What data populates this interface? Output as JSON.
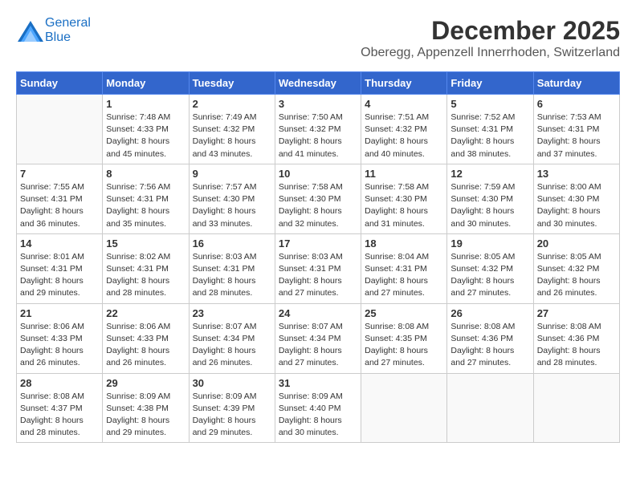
{
  "header": {
    "logo_line1": "General",
    "logo_line2": "Blue",
    "month_title": "December 2025",
    "subtitle": "Oberegg, Appenzell Innerrhoden, Switzerland"
  },
  "weekdays": [
    "Sunday",
    "Monday",
    "Tuesday",
    "Wednesday",
    "Thursday",
    "Friday",
    "Saturday"
  ],
  "weeks": [
    [
      {
        "day": "",
        "info": ""
      },
      {
        "day": "1",
        "info": "Sunrise: 7:48 AM\nSunset: 4:33 PM\nDaylight: 8 hours\nand 45 minutes."
      },
      {
        "day": "2",
        "info": "Sunrise: 7:49 AM\nSunset: 4:32 PM\nDaylight: 8 hours\nand 43 minutes."
      },
      {
        "day": "3",
        "info": "Sunrise: 7:50 AM\nSunset: 4:32 PM\nDaylight: 8 hours\nand 41 minutes."
      },
      {
        "day": "4",
        "info": "Sunrise: 7:51 AM\nSunset: 4:32 PM\nDaylight: 8 hours\nand 40 minutes."
      },
      {
        "day": "5",
        "info": "Sunrise: 7:52 AM\nSunset: 4:31 PM\nDaylight: 8 hours\nand 38 minutes."
      },
      {
        "day": "6",
        "info": "Sunrise: 7:53 AM\nSunset: 4:31 PM\nDaylight: 8 hours\nand 37 minutes."
      }
    ],
    [
      {
        "day": "7",
        "info": "Sunrise: 7:55 AM\nSunset: 4:31 PM\nDaylight: 8 hours\nand 36 minutes."
      },
      {
        "day": "8",
        "info": "Sunrise: 7:56 AM\nSunset: 4:31 PM\nDaylight: 8 hours\nand 35 minutes."
      },
      {
        "day": "9",
        "info": "Sunrise: 7:57 AM\nSunset: 4:30 PM\nDaylight: 8 hours\nand 33 minutes."
      },
      {
        "day": "10",
        "info": "Sunrise: 7:58 AM\nSunset: 4:30 PM\nDaylight: 8 hours\nand 32 minutes."
      },
      {
        "day": "11",
        "info": "Sunrise: 7:58 AM\nSunset: 4:30 PM\nDaylight: 8 hours\nand 31 minutes."
      },
      {
        "day": "12",
        "info": "Sunrise: 7:59 AM\nSunset: 4:30 PM\nDaylight: 8 hours\nand 30 minutes."
      },
      {
        "day": "13",
        "info": "Sunrise: 8:00 AM\nSunset: 4:30 PM\nDaylight: 8 hours\nand 30 minutes."
      }
    ],
    [
      {
        "day": "14",
        "info": "Sunrise: 8:01 AM\nSunset: 4:31 PM\nDaylight: 8 hours\nand 29 minutes."
      },
      {
        "day": "15",
        "info": "Sunrise: 8:02 AM\nSunset: 4:31 PM\nDaylight: 8 hours\nand 28 minutes."
      },
      {
        "day": "16",
        "info": "Sunrise: 8:03 AM\nSunset: 4:31 PM\nDaylight: 8 hours\nand 28 minutes."
      },
      {
        "day": "17",
        "info": "Sunrise: 8:03 AM\nSunset: 4:31 PM\nDaylight: 8 hours\nand 27 minutes."
      },
      {
        "day": "18",
        "info": "Sunrise: 8:04 AM\nSunset: 4:31 PM\nDaylight: 8 hours\nand 27 minutes."
      },
      {
        "day": "19",
        "info": "Sunrise: 8:05 AM\nSunset: 4:32 PM\nDaylight: 8 hours\nand 27 minutes."
      },
      {
        "day": "20",
        "info": "Sunrise: 8:05 AM\nSunset: 4:32 PM\nDaylight: 8 hours\nand 26 minutes."
      }
    ],
    [
      {
        "day": "21",
        "info": "Sunrise: 8:06 AM\nSunset: 4:33 PM\nDaylight: 8 hours\nand 26 minutes."
      },
      {
        "day": "22",
        "info": "Sunrise: 8:06 AM\nSunset: 4:33 PM\nDaylight: 8 hours\nand 26 minutes."
      },
      {
        "day": "23",
        "info": "Sunrise: 8:07 AM\nSunset: 4:34 PM\nDaylight: 8 hours\nand 26 minutes."
      },
      {
        "day": "24",
        "info": "Sunrise: 8:07 AM\nSunset: 4:34 PM\nDaylight: 8 hours\nand 27 minutes."
      },
      {
        "day": "25",
        "info": "Sunrise: 8:08 AM\nSunset: 4:35 PM\nDaylight: 8 hours\nand 27 minutes."
      },
      {
        "day": "26",
        "info": "Sunrise: 8:08 AM\nSunset: 4:36 PM\nDaylight: 8 hours\nand 27 minutes."
      },
      {
        "day": "27",
        "info": "Sunrise: 8:08 AM\nSunset: 4:36 PM\nDaylight: 8 hours\nand 28 minutes."
      }
    ],
    [
      {
        "day": "28",
        "info": "Sunrise: 8:08 AM\nSunset: 4:37 PM\nDaylight: 8 hours\nand 28 minutes."
      },
      {
        "day": "29",
        "info": "Sunrise: 8:09 AM\nSunset: 4:38 PM\nDaylight: 8 hours\nand 29 minutes."
      },
      {
        "day": "30",
        "info": "Sunrise: 8:09 AM\nSunset: 4:39 PM\nDaylight: 8 hours\nand 29 minutes."
      },
      {
        "day": "31",
        "info": "Sunrise: 8:09 AM\nSunset: 4:40 PM\nDaylight: 8 hours\nand 30 minutes."
      },
      {
        "day": "",
        "info": ""
      },
      {
        "day": "",
        "info": ""
      },
      {
        "day": "",
        "info": ""
      }
    ]
  ]
}
